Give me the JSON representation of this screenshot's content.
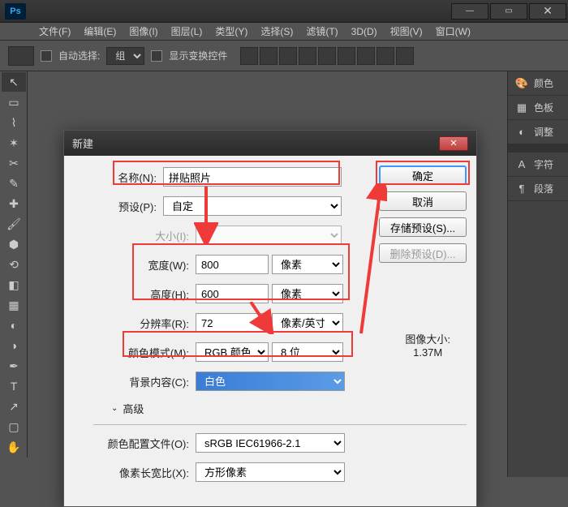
{
  "menu": [
    "文件(F)",
    "编辑(E)",
    "图像(I)",
    "图层(L)",
    "类型(Y)",
    "选择(S)",
    "滤镜(T)",
    "3D(D)",
    "视图(V)",
    "窗口(W)"
  ],
  "options": {
    "auto_select": "自动选择:",
    "group": "组",
    "show_transform": "显示变换控件"
  },
  "panels": {
    "color": "颜色",
    "swatches": "色板",
    "adjustments": "调整",
    "character": "字符",
    "paragraph": "段落"
  },
  "dialog": {
    "title": "新建",
    "name_label": "名称(N):",
    "name_value": "拼贴照片",
    "preset_label": "预设(P):",
    "preset_value": "自定",
    "size_label": "大小(I):",
    "width_label": "宽度(W):",
    "width_value": "800",
    "width_unit": "像素",
    "height_label": "高度(H):",
    "height_value": "600",
    "height_unit": "像素",
    "resolution_label": "分辨率(R):",
    "resolution_value": "72",
    "resolution_unit": "像素/英寸",
    "colormode_label": "颜色模式(M):",
    "colormode_value": "RGB 颜色",
    "depth_value": "8 位",
    "bg_label": "背景内容(C):",
    "bg_value": "白色",
    "advanced": "高级",
    "profile_label": "颜色配置文件(O):",
    "profile_value": "sRGB IEC61966-2.1",
    "aspect_label": "像素长宽比(X):",
    "aspect_value": "方形像素",
    "imagesize_label": "图像大小:",
    "imagesize_value": "1.37M",
    "ok": "确定",
    "cancel": "取消",
    "save_preset": "存储预设(S)...",
    "delete_preset": "删除预设(D)..."
  }
}
